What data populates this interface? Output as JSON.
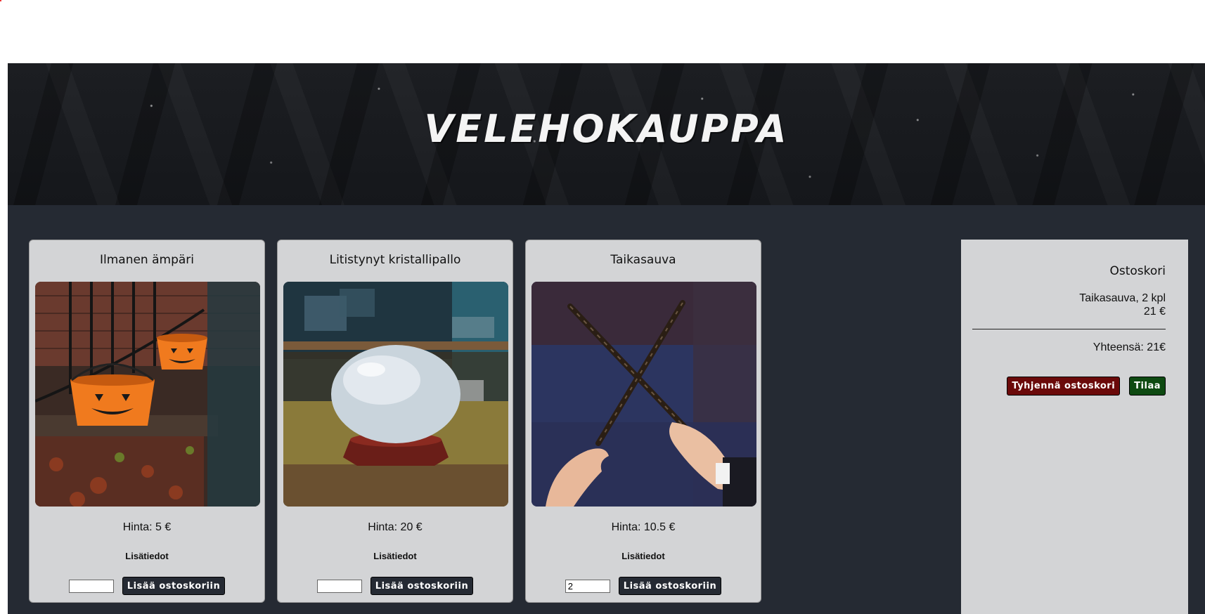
{
  "site": {
    "title": "VELEHOKAUPPA"
  },
  "products": [
    {
      "name": "Ilmanen ämpäri",
      "price": "Hinta: 5 €",
      "info_label": "Lisätiedot",
      "quantity": "",
      "add_label": "Lisää ostoskoriin",
      "image_icon": "pumpkin-buckets-image"
    },
    {
      "name": "Litistynyt kristallipallo",
      "price": "Hinta: 20 €",
      "info_label": "Lisätiedot",
      "quantity": "",
      "add_label": "Lisää ostoskoriin",
      "image_icon": "crystal-ball-image"
    },
    {
      "name": "Taikasauva",
      "price": "Hinta: 10.5 €",
      "info_label": "Lisätiedot",
      "quantity": "2",
      "add_label": "Lisää ostoskoriin",
      "image_icon": "magic-wands-image"
    }
  ],
  "cart": {
    "title": "Ostoskori",
    "item_line": "Taikasauva, 2 kpl",
    "item_price": "21 €",
    "total": "Yhteensä: 21€",
    "clear_label": "Tyhjennä ostoskori",
    "order_label": "Tilaa"
  },
  "colors": {
    "page_bg": "#252a33",
    "card_bg": "#d3d4d6",
    "button_dark": "#252a33",
    "button_red": "#6b0a0a",
    "button_green": "#0e4a12"
  }
}
